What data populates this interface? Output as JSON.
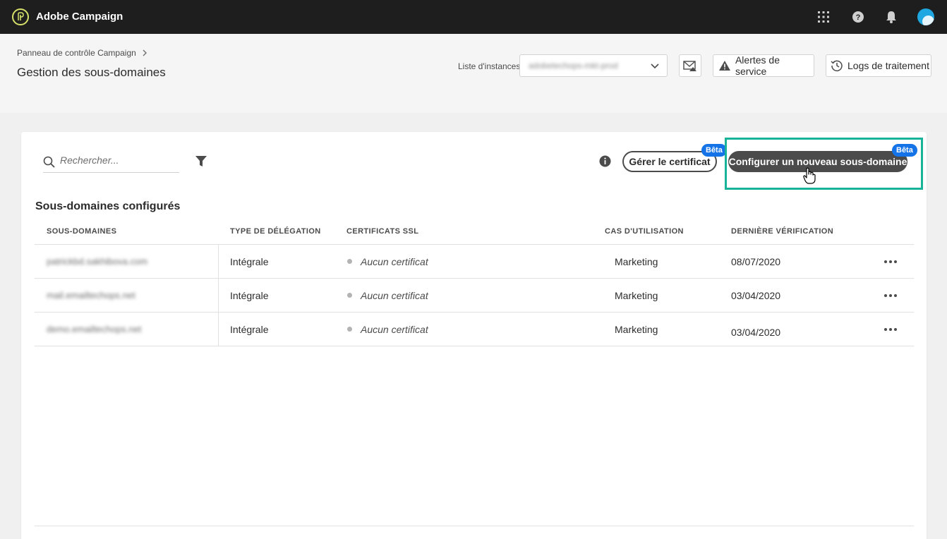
{
  "app": {
    "title": "Adobe Campaign"
  },
  "header": {
    "breadcrumb": "Panneau de contrôle Campaign",
    "title": "Gestion des sous-domaines",
    "instance_label": "Liste d'instances",
    "instance_value": "adobetechops-mkt-prod",
    "alerts_label": "Alertes de service",
    "logs_label": "Logs de traitement"
  },
  "toolbar": {
    "search_placeholder": "Rechercher...",
    "manage_cert_label": "Gérer le certificat",
    "configure_label": "Configurer un nouveau sous-domaine",
    "beta_label": "Bêta"
  },
  "table": {
    "title": "Sous-domaines configurés",
    "columns": [
      "SOUS-DOMAINES",
      "TYPE DE DÉLÉGATION",
      "CERTIFICATS SSL",
      "CAS D'UTILISATION",
      "DERNIÈRE VÉRIFICATION"
    ],
    "rows": [
      {
        "subdomain": "patrickbd.sakhibova.com",
        "delegation": "Intégrale",
        "ssl": "Aucun certificat",
        "usecase": "Marketing",
        "last_check": "08/07/2020"
      },
      {
        "subdomain": "mail.emailtechops.net",
        "delegation": "Intégrale",
        "ssl": "Aucun certificat",
        "usecase": "Marketing",
        "last_check": "03/04/2020"
      },
      {
        "subdomain": "demo.emailtechops.net",
        "delegation": "Intégrale",
        "ssl": "Aucun certificat",
        "usecase": "Marketing",
        "last_check": "03/04/2020"
      }
    ]
  },
  "colors": {
    "accent": "#1473e6",
    "highlight": "#19b39a",
    "topbar": "#1e1e1e"
  }
}
